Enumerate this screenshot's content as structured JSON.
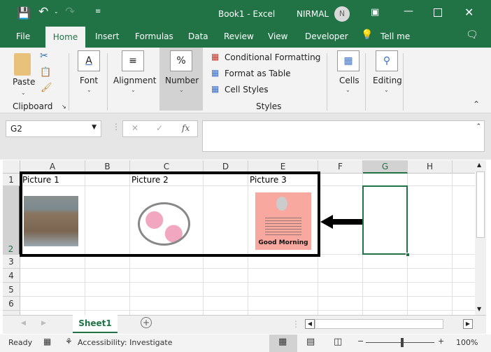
{
  "titlebar": {
    "title": "Book1  -  Excel",
    "user": "NIRMAL",
    "avatar_initial": "N"
  },
  "tabs": [
    {
      "label": "File"
    },
    {
      "label": "Home",
      "active": true
    },
    {
      "label": "Insert"
    },
    {
      "label": "Formulas"
    },
    {
      "label": "Data"
    },
    {
      "label": "Review"
    },
    {
      "label": "View"
    },
    {
      "label": "Developer"
    }
  ],
  "tell_me": "Tell me",
  "ribbon": {
    "paste": "Paste",
    "clipboard": "Clipboard",
    "font": "Font",
    "alignment": "Alignment",
    "number": "Number",
    "number_icon": "%",
    "conditional_formatting": "Conditional Formatting",
    "format_as_table": "Format as Table",
    "cell_styles": "Cell Styles",
    "styles": "Styles",
    "cells": "Cells",
    "editing": "Editing",
    "font_icon": "A"
  },
  "formula_bar": {
    "name_box": "G2",
    "fx": "fx",
    "value": ""
  },
  "grid": {
    "columns": [
      "A",
      "B",
      "C",
      "D",
      "E",
      "F",
      "G",
      "H"
    ],
    "rows": [
      "1",
      "2",
      "3",
      "4",
      "5",
      "6"
    ],
    "cells": {
      "A1": "Picture 1",
      "C1": "Picture 2",
      "E1": "Picture 3"
    },
    "selected_cell": "G2",
    "picture3_caption": "Good Morning"
  },
  "sheets": [
    {
      "label": "Sheet1",
      "active": true
    }
  ],
  "status": {
    "ready": "Ready",
    "accessibility": "Accessibility: Investigate",
    "zoom": "100%",
    "zoom_level": 100
  },
  "colors": {
    "brand": "#217346",
    "selection": "#217346"
  }
}
